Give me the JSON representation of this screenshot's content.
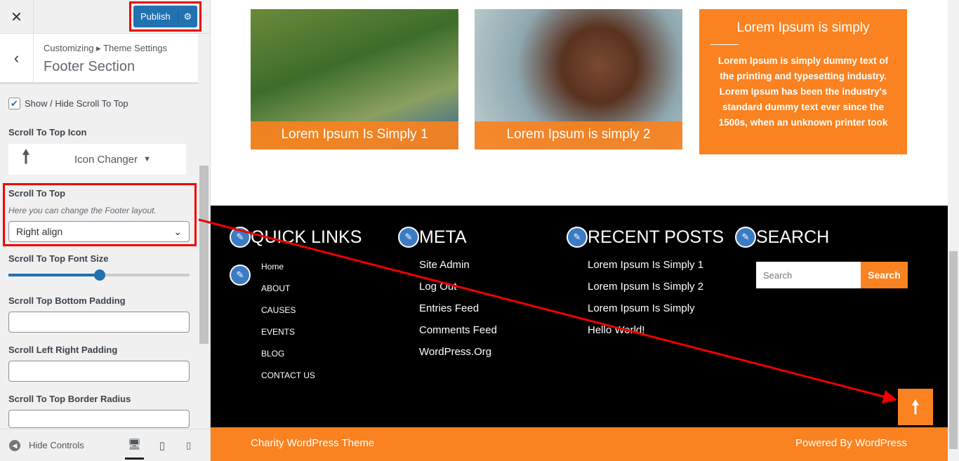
{
  "sidebar": {
    "close": "✕",
    "publish": "Publish",
    "crumb": "Customizing ▸ Theme Settings",
    "title": "Footer Section",
    "show_hide": "Show / Hide Scroll To Top",
    "icon_label": "Scroll To Top Icon",
    "icon_changer": "Icon Changer",
    "stt_label": "Scroll To Top",
    "stt_desc": "Here you can change the Footer layout.",
    "stt_value": "Right align",
    "font_size": "Scroll To Top Font Size",
    "font_slider_percent": 50,
    "bottom_padding": "Scroll Top Bottom Padding",
    "lr_padding": "Scroll Left Right Padding",
    "radius": "Scroll To Top Border Radius",
    "hide_controls": "Hide Controls"
  },
  "cards": [
    {
      "caption": "Lorem Ipsum Is Simply 1"
    },
    {
      "caption": "Lorem Ipsum is simply 2"
    }
  ],
  "text_card": {
    "title": "Lorem Ipsum is simply",
    "body": "Lorem Ipsum is simply dummy text of the printing and typesetting industry. Lorem Ipsum has been the industry's standard dummy text ever since the 1500s, when an unknown printer took"
  },
  "footer": {
    "quick_links": {
      "title": "QUICK LINKS",
      "items": [
        "Home",
        "ABOUT",
        "CAUSES",
        "EVENTS",
        "BLOG",
        "CONTACT US"
      ]
    },
    "meta": {
      "title": "META",
      "items": [
        "Site Admin",
        "Log Out",
        "Entries Feed",
        "Comments Feed",
        "WordPress.Org"
      ]
    },
    "recent": {
      "title": "RECENT POSTS",
      "items": [
        "Lorem Ipsum Is Simply 1",
        "Lorem Ipsum Is Simply 2",
        "Lorem Ipsum Is Simply",
        "Hello World!"
      ]
    },
    "search": {
      "title": "SEARCH",
      "placeholder": "Search",
      "button": "Search"
    }
  },
  "bottom": {
    "left": "Charity WordPress Theme",
    "right": "Powered By WordPress"
  },
  "colors": {
    "accent": "#fa8220",
    "publish": "#2271b1",
    "annotation": "#ee0000"
  }
}
